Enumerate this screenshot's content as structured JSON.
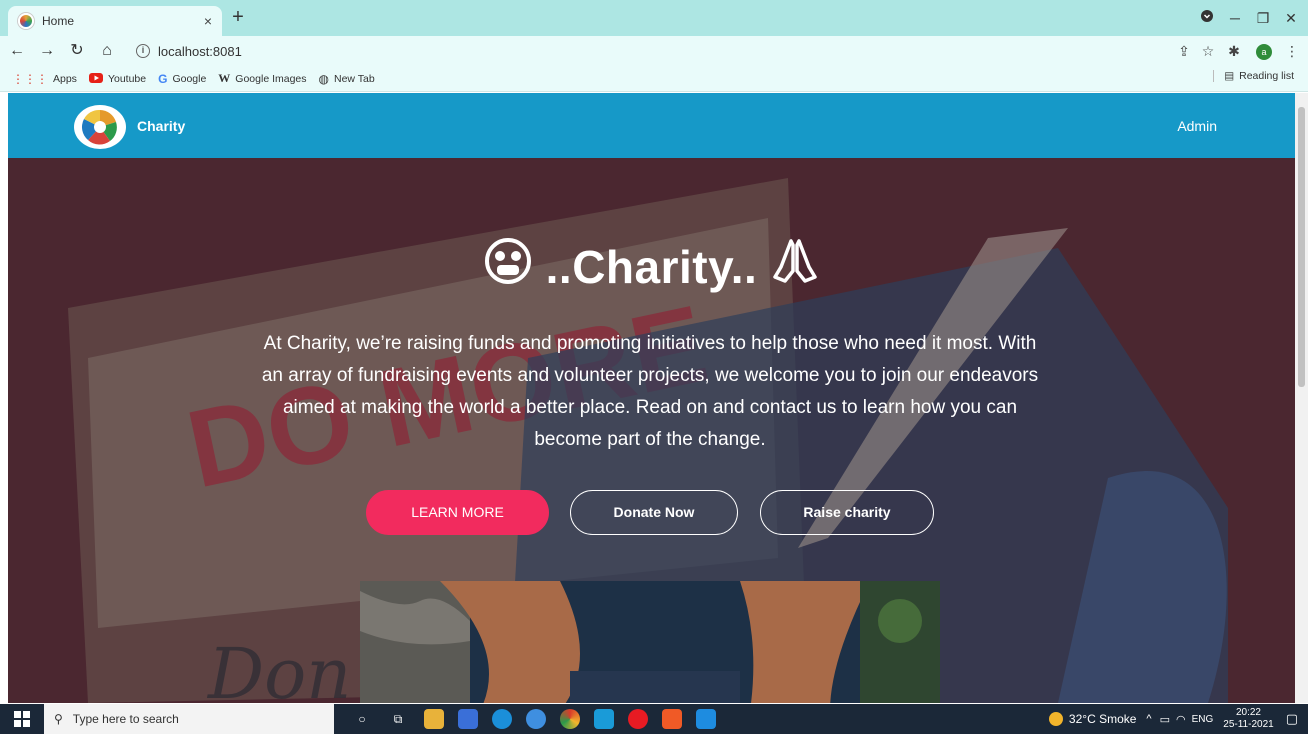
{
  "browser": {
    "tab_title": "Home",
    "tab_close": "×",
    "new_tab": "+",
    "url": "localhost:8081",
    "bookmarks": [
      {
        "label": "Apps",
        "icon": "apps-grid-icon"
      },
      {
        "label": "Youtube",
        "icon": "youtube-icon"
      },
      {
        "label": "Google",
        "icon": "google-icon"
      },
      {
        "label": "Google Images",
        "icon": "wikipedia-icon"
      },
      {
        "label": "New Tab",
        "icon": "globe-icon"
      }
    ],
    "reading_list": "Reading list",
    "profile_initial": "a"
  },
  "site": {
    "brand": "Charity",
    "admin_link": "Admin",
    "hero_title": "..Charity..",
    "hero_text": "At Charity, we’re raising funds and promoting initiatives to help those who need it most. With an array of fundraising events and volunteer projects, we welcome you to join our endeavors aimed at making the world a better place. Read on and contact us to learn how you can become part of the change.",
    "btn_learn": "LEARN MORE",
    "btn_donate": "Donate Now",
    "btn_raise": "Raise charity",
    "bg_text": "DO MORE",
    "bg_script": "Don",
    "colors": {
      "navbar": "#1699c8",
      "primary_button": "#f22b5e",
      "hero_overlay": "#4b2730"
    }
  },
  "taskbar": {
    "search_placeholder": "Type here to search",
    "weather": "32°C  Smoke",
    "language": "ENG",
    "time": "20:22",
    "date": "25-11-2021"
  }
}
